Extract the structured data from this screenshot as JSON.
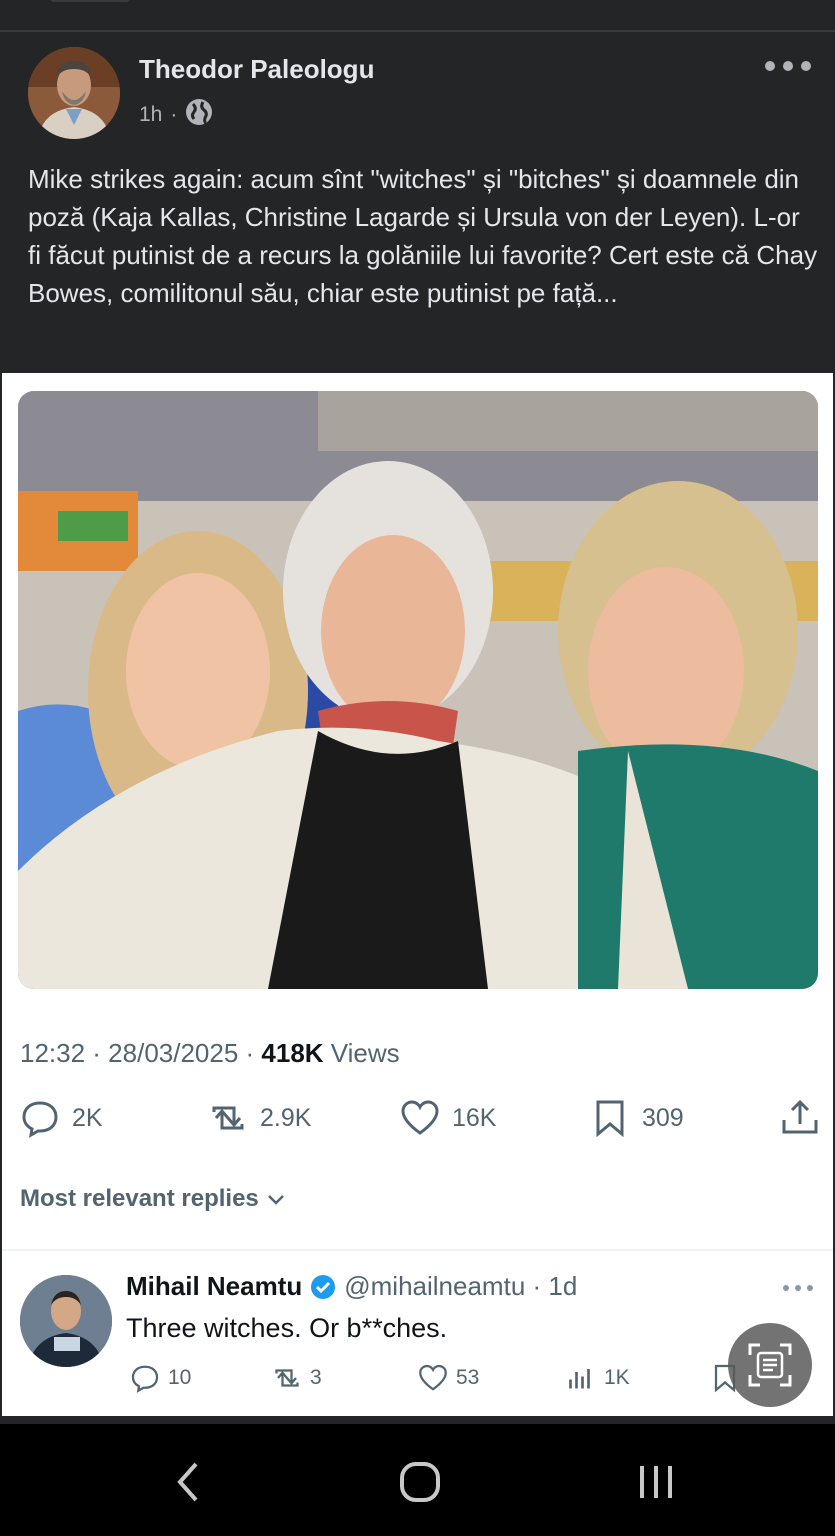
{
  "post": {
    "author": "Theodor Paleologu",
    "time": "1h",
    "separator": "·",
    "privacy_icon": "globe-icon",
    "text": "Mike strikes again: acum sînt \"witches\" și \"bitches\" și doamnele din poză (Kaja Kallas, Christine Lagarde și Ursula von der Leyen). L-or fi făcut putinist de a recurs la golăniile lui favorite? Cert este că Chay Bowes, comilitonul său, chiar este putinist pe față..."
  },
  "tweet": {
    "time": "12:32 · 28/03/2025 · ",
    "views_count": "418K",
    "views_label": " Views",
    "replies": "2K",
    "reposts": "2.9K",
    "likes": "16K",
    "bookmarks": "309",
    "replies_header": "Most relevant replies"
  },
  "reply": {
    "name": "Mihail Neamtu",
    "handle": "@mihailneamtu · 1d",
    "text": "Three witches. Or b**ches.",
    "replies": "10",
    "reposts": "3",
    "likes": "53",
    "views": "1K"
  },
  "colors": {
    "background": "#242526",
    "text": "#e4e6eb",
    "muted": "#b0b3b8",
    "twitter_muted": "#536471",
    "verified": "#1d9bf0"
  }
}
